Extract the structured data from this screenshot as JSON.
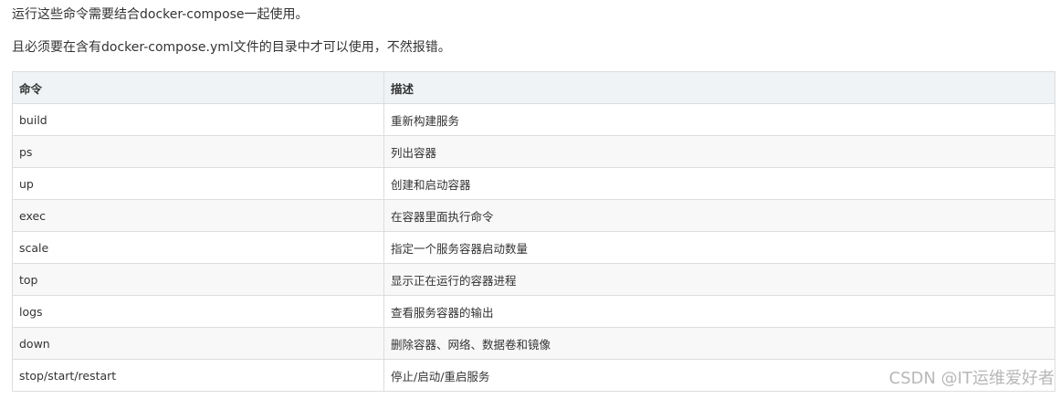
{
  "intro": {
    "line1": "运行这些命令需要结合docker-compose一起使用。",
    "line2": "且必须要在含有docker-compose.yml文件的目录中才可以使用，不然报错。"
  },
  "table": {
    "headers": [
      "命令",
      "描述"
    ],
    "rows": [
      [
        "build",
        "重新构建服务"
      ],
      [
        "ps",
        "列出容器"
      ],
      [
        "up",
        "创建和启动容器"
      ],
      [
        "exec",
        "在容器里面执行命令"
      ],
      [
        "scale",
        "指定一个服务容器启动数量"
      ],
      [
        "top",
        "显示正在运行的容器进程"
      ],
      [
        "logs",
        "查看服务容器的输出"
      ],
      [
        "down",
        "删除容器、网络、数据卷和镜像"
      ],
      [
        "stop/start/restart",
        "停止/启动/重启服务"
      ]
    ]
  },
  "watermark": "CSDN @IT运维爱好者"
}
